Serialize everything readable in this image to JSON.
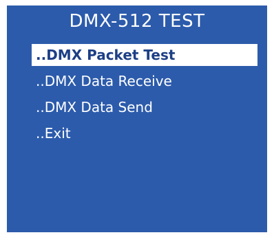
{
  "screen": {
    "title": "DMX-512 TEST",
    "background_color": "#2c5bab",
    "text_color": "#ffffff",
    "selected_text_color": "#1d3f86",
    "selected_background_color": "#ffffff"
  },
  "menu": {
    "items": [
      {
        "label": "..DMX Packet Test",
        "selected": true
      },
      {
        "label": "..DMX Data Receive",
        "selected": false
      },
      {
        "label": "..DMX Data Send",
        "selected": false
      },
      {
        "label": "..Exit",
        "selected": false
      }
    ]
  }
}
